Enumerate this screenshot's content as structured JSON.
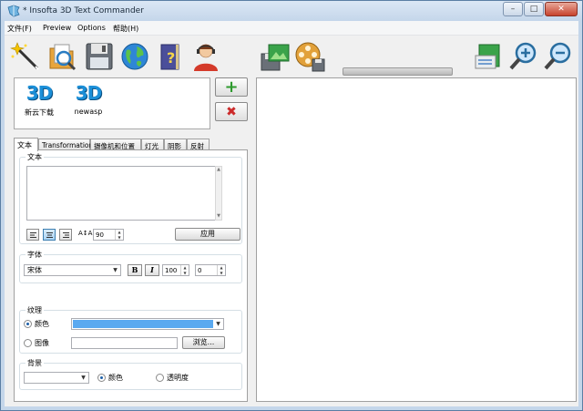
{
  "window": {
    "title": "* Insofta 3D Text Commander",
    "minimize_glyph": "–",
    "maximize_glyph": "□",
    "close_glyph": "✕"
  },
  "menu": [
    "文件(F)",
    "Preview",
    "Options",
    "帮助(H)"
  ],
  "toolbar": {
    "icons": [
      "magic-wand-icon",
      "open-folder-icon",
      "save-icon",
      "web-globe-icon",
      "help-book-icon",
      "support-person-icon",
      "save-image-icon",
      "save-video-icon",
      "export-icon",
      "zoom-in-icon",
      "zoom-out-icon"
    ]
  },
  "templates": [
    {
      "glyph": "3D",
      "label": "新云下载"
    },
    {
      "glyph": "3D",
      "label": "newasp"
    }
  ],
  "side_buttons": {
    "add": "+",
    "remove": "✖"
  },
  "tabs": [
    "文本",
    "Transformation",
    "摄像机和位置",
    "灯光",
    "阴影",
    "反射"
  ],
  "text_group": {
    "title": "文本",
    "text": "",
    "spacing_value": "90",
    "apply_label": "应用",
    "spacing_icon_text": "A↕A"
  },
  "font_group": {
    "title": "字体",
    "font_name": "宋体",
    "bold_glyph": "B",
    "italic_glyph": "I",
    "size_value": "100",
    "offset_value": "0"
  },
  "texture_group": {
    "title": "纹理",
    "color_label": "颜色",
    "image_label": "图像",
    "browse_label": "浏览...",
    "color_value": "#5aa9f0",
    "image_path": ""
  },
  "background_group": {
    "title": "背景",
    "selected": "",
    "color_label": "颜色",
    "transparency_label": "透明度"
  },
  "scroll": {
    "up": "▲",
    "down": "▼"
  },
  "dropdown_arrow": "▼"
}
